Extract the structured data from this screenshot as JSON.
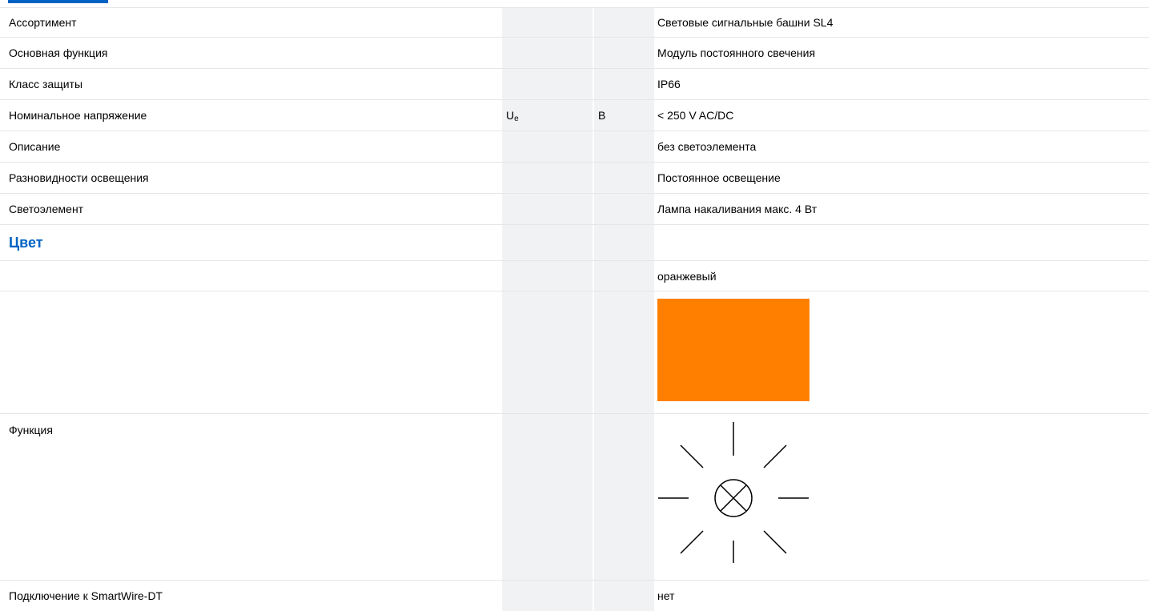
{
  "rows": [
    {
      "label": "Ассортимент",
      "value": "Световые сигнальные башни SL4"
    },
    {
      "label": "Основная функция",
      "value": "Модуль постоянного свечения"
    },
    {
      "label": "Класс защиты",
      "value": "IP66"
    },
    {
      "label": "Номинальное напряжение",
      "symbol": "U",
      "symbol_sub": "e",
      "unit": "В",
      "value": "< 250 V AC/DC"
    },
    {
      "label": "Описание",
      "value": "без светоэлемента"
    },
    {
      "label": "Разновидности освещения",
      "value": "Постоянное освещение"
    },
    {
      "label": "Светоэлемент",
      "value": "Лампа накаливания макс. 4 Вт"
    }
  ],
  "color_section": {
    "title": "Цвет",
    "value": "оранжевый",
    "swatch_color": "#ff8000"
  },
  "function_row": {
    "label": "Функция",
    "icon": "lamp-steady-icon"
  },
  "smartwire_row": {
    "label": "Подключение к SmartWire-DT",
    "value": "нет"
  },
  "colors": {
    "accent": "#0063c3",
    "column_shade": "#f1f2f4",
    "divider": "#e6e6e6"
  }
}
